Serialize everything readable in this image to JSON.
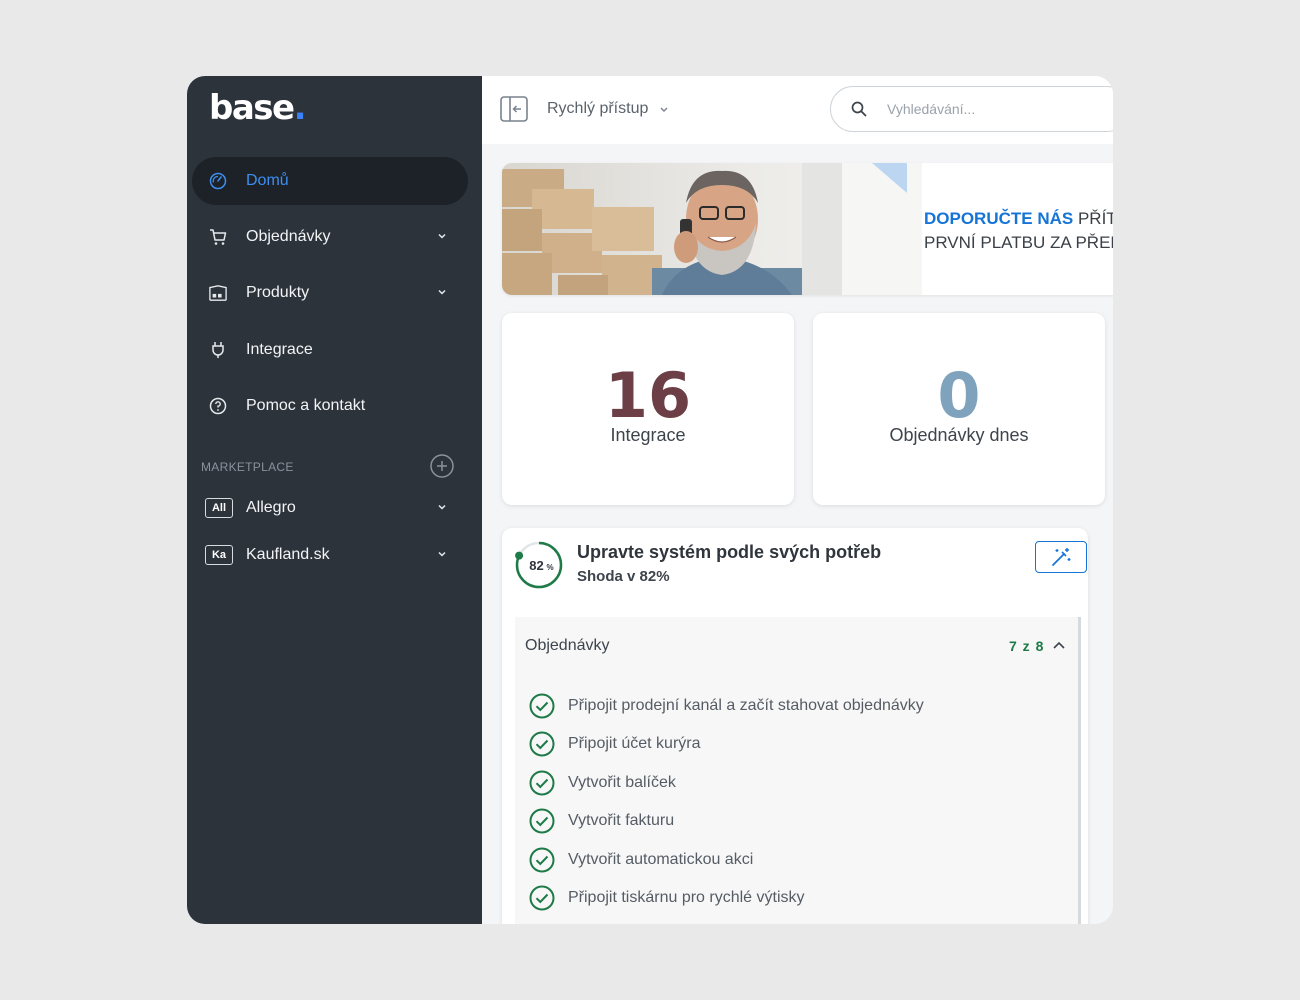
{
  "app": {
    "logo_text": "base",
    "logo_dot": ".",
    "accent_color": "#3b82f6"
  },
  "sidebar": {
    "items": [
      {
        "label": "Domů",
        "icon": "dashboard-icon",
        "active": true
      },
      {
        "label": "Objednávky",
        "icon": "cart-icon",
        "expandable": true
      },
      {
        "label": "Produkty",
        "icon": "warehouse-icon",
        "expandable": true
      },
      {
        "label": "Integrace",
        "icon": "plug-icon"
      },
      {
        "label": "Pomoc a kontakt",
        "icon": "help-icon"
      }
    ],
    "marketplace_label": "MARKETPLACE",
    "marketplaces": [
      {
        "badge": "All",
        "label": "Allegro"
      },
      {
        "badge": "Ka",
        "label": "Kaufland.sk"
      }
    ]
  },
  "topbar": {
    "quick_access_label": "Rychlý přístup",
    "search_placeholder": "Vyhledávání..."
  },
  "banner": {
    "highlight": "DOPORUČTE NÁS",
    "line1_rest": " PŘÍT",
    "line2": "PRVNÍ PLATBU ZA PŘED"
  },
  "stats": [
    {
      "value": "16",
      "label": "Integrace",
      "color": "#6b3f45"
    },
    {
      "value": "0",
      "label": "Objednávky dnes",
      "color": "#7fa3bd"
    }
  ],
  "setup": {
    "progress_percent": 82,
    "progress_text": "82",
    "progress_unit": "%",
    "title": "Upravte systém podle svých potřeb",
    "subtitle": "Shoda v 82%",
    "section_title": "Objednávky",
    "section_count": "7 z 8",
    "tasks": [
      "Připojit prodejní kanál a začít stahovat objednávky",
      "Připojit účet kurýra",
      "Vytvořit balíček",
      "Vytvořit fakturu",
      "Vytvořit automatickou akci",
      "Připojit tiskárnu pro rychlé výtisky"
    ],
    "done_color": "#1e7a46"
  }
}
